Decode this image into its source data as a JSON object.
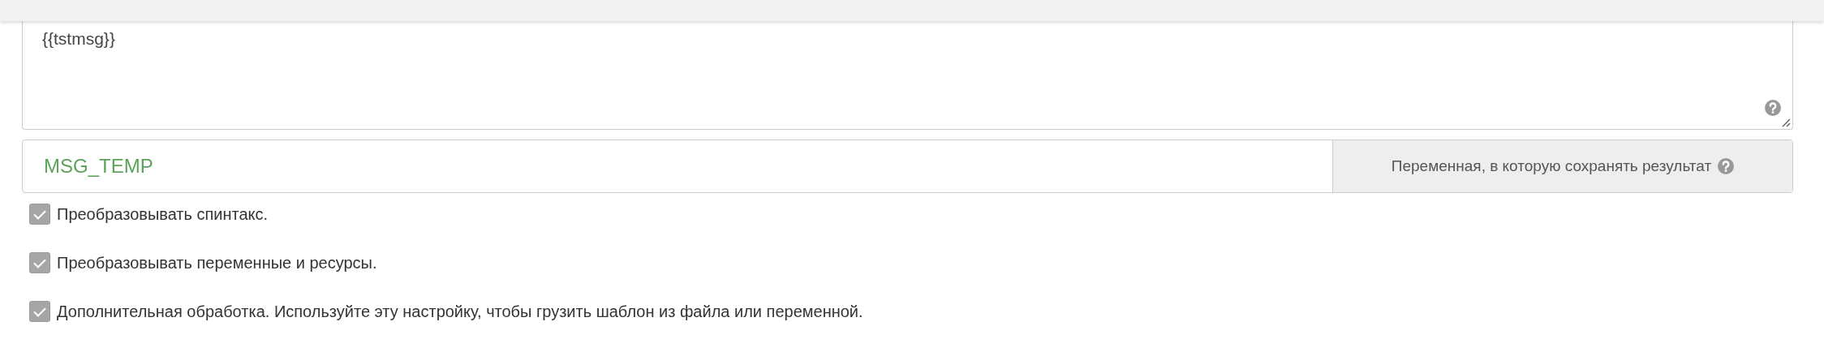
{
  "template_field": {
    "value": "{{tstmsg}}"
  },
  "result_variable": {
    "value": "MSG_TEMP",
    "addon_label": "Переменная, в которую сохранять результат"
  },
  "options": [
    {
      "label": "Преобразовывать спинтакс.",
      "checked": true
    },
    {
      "label": "Преобразовывать переменные и ресурсы.",
      "checked": true
    },
    {
      "label": "Дополнительная обработка. Используйте эту настройку, чтобы грузить шаблон из файла или переменной.",
      "checked": true
    }
  ]
}
